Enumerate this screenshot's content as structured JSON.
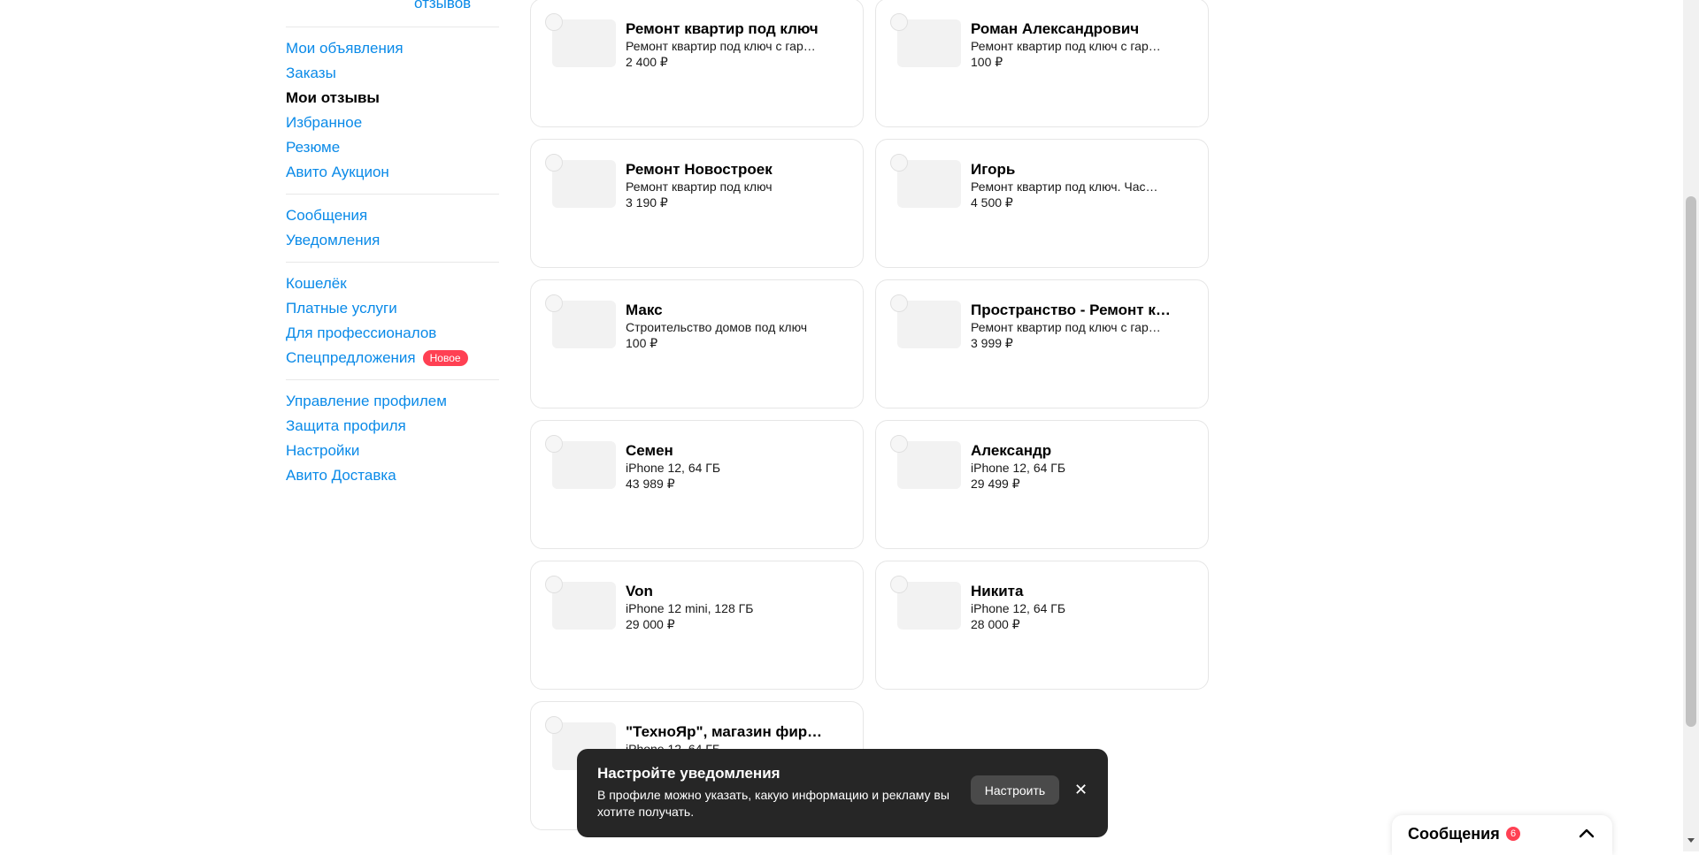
{
  "sidebar": {
    "top_link": "отзывов",
    "groups": [
      [
        {
          "label": "Мои объявления"
        },
        {
          "label": "Заказы"
        },
        {
          "label": "Мои отзывы",
          "active": true
        },
        {
          "label": "Избранное"
        },
        {
          "label": "Резюме"
        },
        {
          "label": "Авито Аукцион"
        }
      ],
      [
        {
          "label": "Сообщения"
        },
        {
          "label": "Уведомления"
        }
      ],
      [
        {
          "label": "Кошелёк"
        },
        {
          "label": "Платные услуги"
        },
        {
          "label": "Для профессионалов"
        },
        {
          "label": "Спецпредложения",
          "badge": "Новое"
        }
      ],
      [
        {
          "label": "Управление профилем"
        },
        {
          "label": "Защита профиля"
        },
        {
          "label": "Настройки"
        },
        {
          "label": "Авито Доставка"
        }
      ]
    ]
  },
  "cards": [
    {
      "title": "Ремонт квартир под ключ",
      "subtitle": "Ремонт квартир под ключ с гар…",
      "price": "2 400 ₽"
    },
    {
      "title": "Роман Александрович",
      "subtitle": "Ремонт квартир под ключ с гар…",
      "price": "100 ₽"
    },
    {
      "title": "Ремонт Новостроек",
      "subtitle": "Ремонт квартир под ключ",
      "price": "3 190 ₽"
    },
    {
      "title": "Игорь",
      "subtitle": "Ремонт квартир под ключ. Час…",
      "price": "4 500 ₽"
    },
    {
      "title": "Макс",
      "subtitle": "Строительство домов под ключ",
      "price": "100 ₽"
    },
    {
      "title": "Пространство - Ремонт к…",
      "subtitle": "Ремонт квартир под ключ с гар…",
      "price": "3 999 ₽"
    },
    {
      "title": "Семен",
      "subtitle": "iPhone 12, 64 ГБ",
      "price": "43 989 ₽"
    },
    {
      "title": "Александр",
      "subtitle": "iPhone 12, 64 ГБ",
      "price": "29 499 ₽"
    },
    {
      "title": "Von",
      "subtitle": "iPhone 12 mini, 128 ГБ",
      "price": "29 000 ₽"
    },
    {
      "title": "Никита",
      "subtitle": "iPhone 12, 64 ГБ",
      "price": "28 000 ₽"
    },
    {
      "title": "\"ТехноЯр\", магазин фирм…",
      "subtitle": "iPhone 12, 64 ГБ",
      "price": ""
    }
  ],
  "toast": {
    "title": "Настройте уведомления",
    "text": "В профиле можно указать, какую информацию и рекламу вы хотите получать.",
    "button": "Настроить",
    "close": "✕"
  },
  "messages_widget": {
    "title": "Сообщения",
    "count": "6"
  }
}
